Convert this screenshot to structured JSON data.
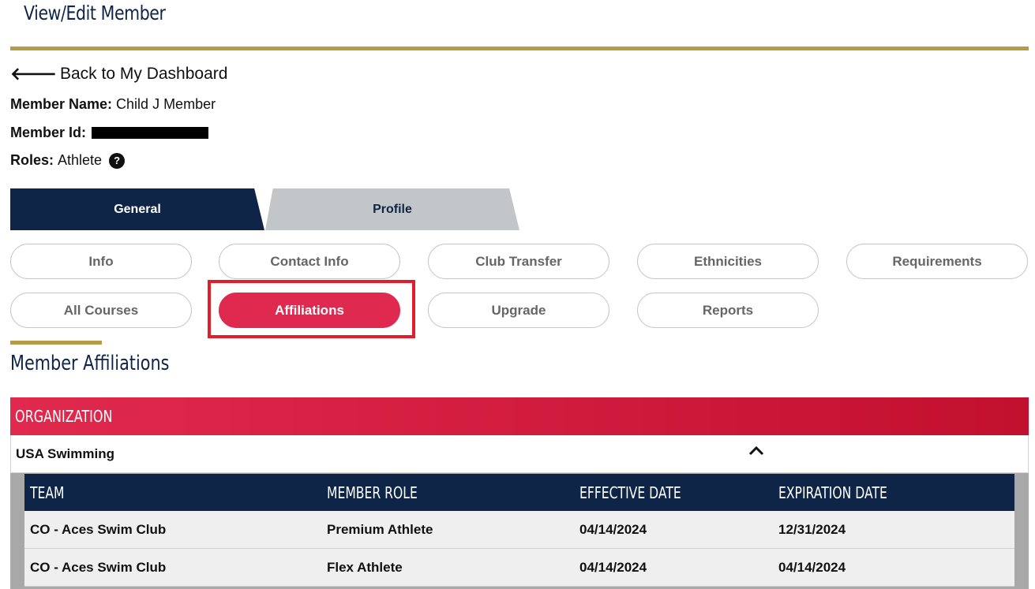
{
  "header": {
    "title": "View/Edit Member"
  },
  "back_link": {
    "arrow": "🡐",
    "label": "Back to My Dashboard"
  },
  "member": {
    "name_label": "Member Name:",
    "name": "Child J Member",
    "id_label": "Member Id:",
    "roles_label": "Roles:",
    "roles": "Athlete",
    "help_icon": "?"
  },
  "tabs": [
    {
      "label": "General",
      "active": true
    },
    {
      "label": "Profile",
      "active": false
    }
  ],
  "subnav": [
    {
      "label": "Info"
    },
    {
      "label": "Contact Info"
    },
    {
      "label": "Club Transfer"
    },
    {
      "label": "Ethnicities"
    },
    {
      "label": "Requirements"
    },
    {
      "label": "All Courses"
    },
    {
      "label": "Affiliations",
      "active": true
    },
    {
      "label": "Upgrade"
    },
    {
      "label": "Reports"
    }
  ],
  "section": {
    "title": "Member Affiliations"
  },
  "organization": {
    "header": "ORGANIZATION",
    "name": "USA Swimming",
    "toggle_icon": "chevron-up-icon"
  },
  "table": {
    "columns": [
      "TEAM",
      "MEMBER ROLE",
      "EFFECTIVE DATE",
      "EXPIRATION DATE"
    ],
    "rows": [
      [
        "CO - Aces Swim Club",
        "Premium Athlete",
        "04/14/2024",
        "12/31/2024"
      ],
      [
        "CO - Aces Swim Club",
        "Flex Athlete",
        "04/14/2024",
        "04/14/2024"
      ]
    ]
  },
  "colors": {
    "navy": "#0f2548",
    "gold": "#b59b45",
    "accent_red": "#e0294e",
    "highlight_red": "#e31d2a",
    "tab_inactive": "#c3c6c9"
  }
}
